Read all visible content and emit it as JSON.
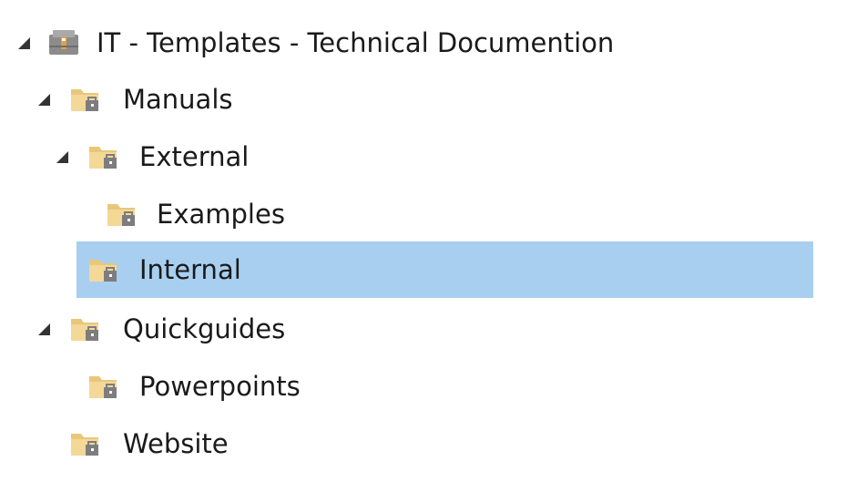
{
  "tree": {
    "root": {
      "label": "IT - Templates - Technical Documention",
      "icon": "sharepoint-library-icon",
      "expanded": true
    },
    "items": [
      {
        "label": "Manuals",
        "icon": "folder-icon",
        "expanded": true
      },
      {
        "label": "External",
        "icon": "folder-icon",
        "expanded": true
      },
      {
        "label": "Examples",
        "icon": "folder-icon"
      },
      {
        "label": "Internal",
        "icon": "folder-icon",
        "selected": true
      },
      {
        "label": "Quickguides",
        "icon": "folder-icon",
        "expanded": true
      },
      {
        "label": "Powerpoints",
        "icon": "folder-icon"
      },
      {
        "label": "Website",
        "icon": "folder-icon"
      }
    ]
  },
  "colors": {
    "selection": "#a8cff0",
    "folder": "#e9c77a",
    "text": "#1a1a1a"
  }
}
